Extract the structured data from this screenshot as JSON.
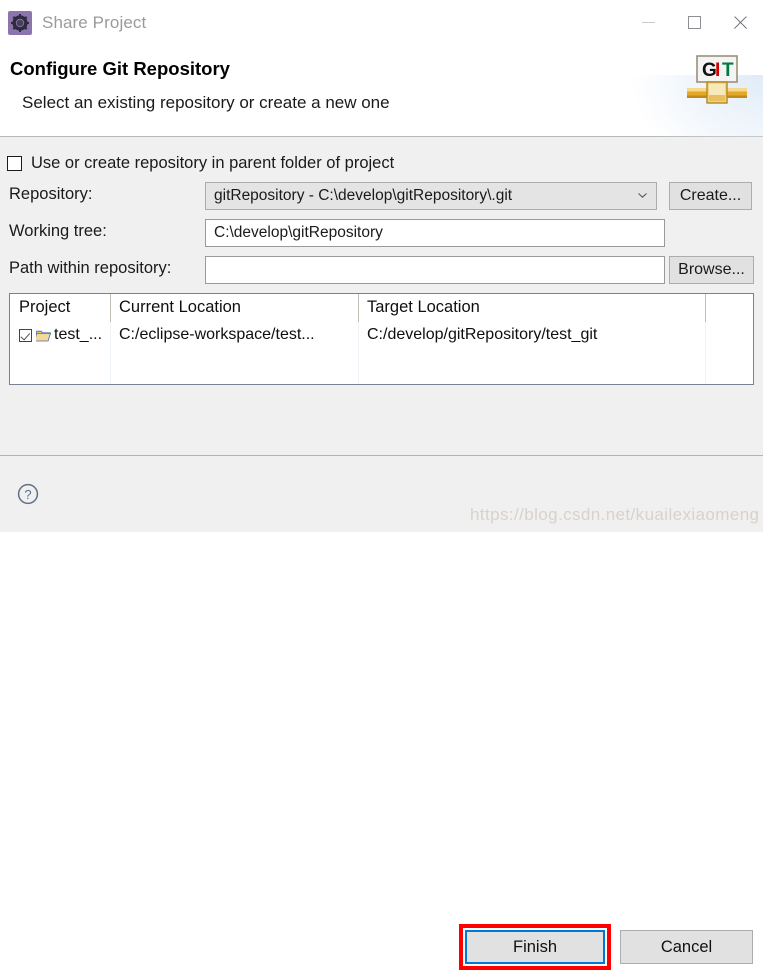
{
  "window": {
    "title": "Share Project",
    "icon": "gear-icon",
    "controls": {
      "minimize": "minimize-icon",
      "maximize": "maximize-icon",
      "close": "close-icon"
    }
  },
  "header": {
    "title": "Configure Git Repository",
    "subtitle": "Select an existing repository or create a new one",
    "logo": {
      "name": "git-logo",
      "letters": [
        "G",
        "I",
        "T"
      ],
      "colors": [
        "#111111",
        "#d40000",
        "#007a3d"
      ]
    }
  },
  "form": {
    "parent_folder_checkbox": {
      "label": "Use or create repository in parent folder of project",
      "checked": false
    },
    "repository": {
      "label": "Repository:",
      "value": "gitRepository - C:\\develop\\gitRepository\\.git",
      "button": "Create..."
    },
    "working_tree": {
      "label": "Working tree:",
      "value": "C:\\develop\\gitRepository"
    },
    "path_within_repository": {
      "label": "Path within repository:",
      "value": "",
      "placeholder": "",
      "button": "Browse..."
    }
  },
  "table": {
    "columns": [
      "Project",
      "Current Location",
      "Target Location",
      ""
    ],
    "rows": [
      {
        "checked": true,
        "project": "test_...",
        "current_location": "C:/eclipse-workspace/test...",
        "target_location": "C:/develop/gitRepository/test_git"
      }
    ]
  },
  "footer": {
    "help": "?",
    "finish_label": "Finish",
    "cancel_label": "Cancel",
    "highlight_color": "#ff0000",
    "focus_color": "#0078d7"
  },
  "watermark": {
    "text": "https://blog.csdn.net/kuailexiaomeng"
  }
}
